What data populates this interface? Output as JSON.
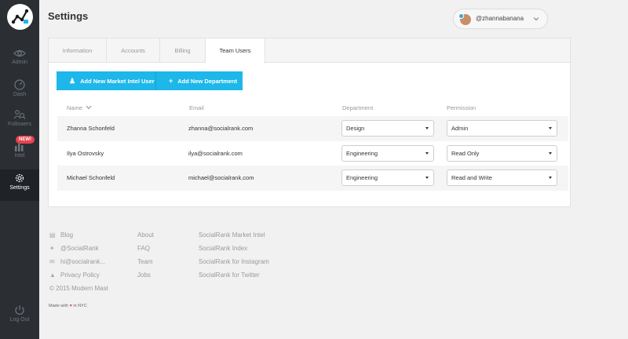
{
  "sidebar": {
    "items": [
      {
        "label": "Admin",
        "icon": "eye-icon"
      },
      {
        "label": "Dash",
        "icon": "gauge-icon"
      },
      {
        "label": "Followers",
        "icon": "people-search-icon"
      },
      {
        "label": "Intel",
        "icon": "bar-chart-icon",
        "badge": "NEW!"
      },
      {
        "label": "Settings",
        "icon": "gear-icon",
        "active": true
      }
    ],
    "logout": "Log Out"
  },
  "header": {
    "title": "Settings",
    "username": "@zhannabanana"
  },
  "tabs": [
    "Information",
    "Accounts",
    "Billing",
    "Team Users"
  ],
  "active_tab": "Team Users",
  "actions": {
    "add_user": "Add New Market Intel User",
    "add_department": "Add New Department"
  },
  "table": {
    "headers": {
      "name": "Name",
      "email": "Email",
      "department": "Department",
      "permission": "Permission"
    },
    "rows": [
      {
        "name": "Zhanna Schonfeld",
        "email": "zhanna@socialrank.com",
        "department": "Design",
        "permission": "Admin"
      },
      {
        "name": "Ilya Ostrovsky",
        "email": "ilya@socialrank.com",
        "department": "Engineering",
        "permission": "Read Only"
      },
      {
        "name": "Michael Schonfeld",
        "email": "michael@socialrank.com",
        "department": "Engineering",
        "permission": "Read and Write"
      }
    ]
  },
  "footer": {
    "col1": [
      "Blog",
      "@SocialRank",
      "hi@socialrank...",
      "Privacy Policy",
      "© 2015 Modern Mast"
    ],
    "col2": [
      "About",
      "FAQ",
      "Team",
      "Jobs"
    ],
    "col3": [
      "SocialRank Market Intel",
      "SocialRank Index",
      "SocialRank for Instagram",
      "SocialRank for Twitter"
    ],
    "made_prefix": "Made with",
    "made_suffix": "in NYC"
  },
  "colors": {
    "accent": "#1db7ea",
    "sidebar": "#2b2f33",
    "badge": "#e8424f"
  }
}
